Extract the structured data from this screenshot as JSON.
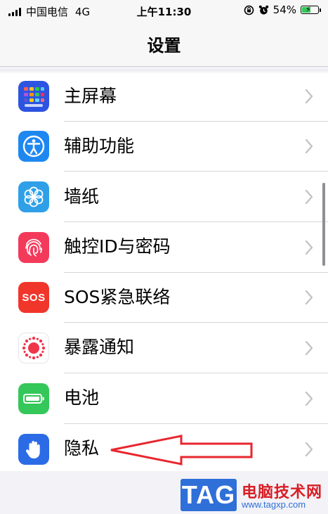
{
  "status_bar": {
    "carrier": "中国电信",
    "network": "4G",
    "time": "上午11:30",
    "battery_percent": "54%",
    "battery_level": 0.54,
    "icons": [
      "signal-icon",
      "orientation-lock-icon",
      "alarm-icon",
      "battery-icon",
      "charging-bolt-icon"
    ]
  },
  "nav": {
    "title": "设置"
  },
  "settings": {
    "items": [
      {
        "label": "主屏幕",
        "icon": "home-screen-icon",
        "color": "#2c54e0"
      },
      {
        "label": "辅助功能",
        "icon": "accessibility-icon",
        "color": "#1e88f0"
      },
      {
        "label": "墙纸",
        "icon": "wallpaper-icon",
        "color": "#2fa0e8"
      },
      {
        "label": "触控ID与密码",
        "icon": "fingerprint-icon",
        "color": "#f33a5b"
      },
      {
        "label": "SOS紧急联络",
        "icon": "sos-icon",
        "color": "#f0352b",
        "badge": "SOS"
      },
      {
        "label": "暴露通知",
        "icon": "exposure-icon",
        "color": "#ffffff"
      },
      {
        "label": "电池",
        "icon": "battery-settings-icon",
        "color": "#34c759"
      },
      {
        "label": "隐私",
        "icon": "privacy-hand-icon",
        "color": "#2c6be6"
      }
    ]
  },
  "watermark": {
    "tag": "TAG",
    "name": "电脑技术网",
    "url": "www.tagxp.com"
  },
  "colors": {
    "annotation": "#e8262e",
    "chevron": "#c4c4c7",
    "separator": "#d6d6da"
  }
}
